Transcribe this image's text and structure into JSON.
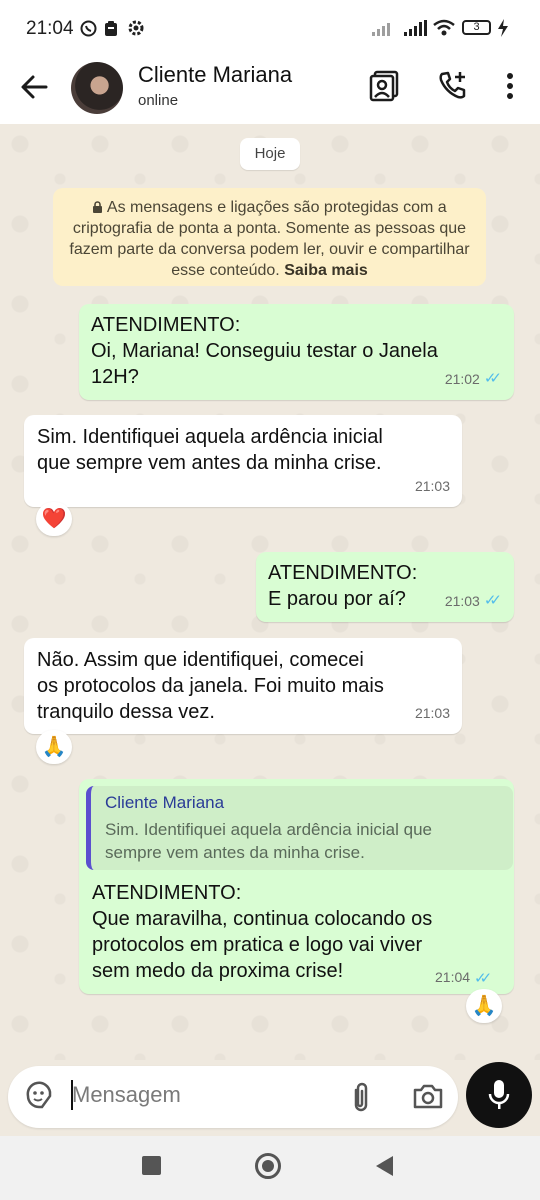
{
  "status_bar": {
    "time": "21:04",
    "battery": "3"
  },
  "header": {
    "back_icon": "arrow-left-icon",
    "contact_name": "Cliente Mariana",
    "contact_status": "online"
  },
  "date_chip": "Hoje",
  "encryption_notice": {
    "text": "As mensagens e ligações são protegidas com a criptografia de ponta a ponta. Somente as pessoas que fazem parte da conversa podem ler, ouvir e compartilhar esse conteúdo.",
    "link": "Saiba mais"
  },
  "messages": [
    {
      "text": "ATENDIMENTO:\nOi, Mariana! Conseguiu testar o Janela\n12H?",
      "time": "21:02"
    },
    {
      "text": "Sim. Identifiquei aquela ardência inicial\nque sempre vem antes da minha crise.",
      "time": "21:03",
      "reaction": "❤️"
    },
    {
      "text": "ATENDIMENTO:\nE parou por aí?",
      "time": "21:03"
    },
    {
      "text": "Não. Assim que identifiquei, comecei\nos protocolos da janela. Foi muito mais\ntranquilo dessa vez.",
      "time": "21:03",
      "reaction": "🙏"
    },
    {
      "quote_name": "Cliente Mariana",
      "quote_text": "Sim. Identifiquei aquela ardência inicial que\nsempre vem antes da minha crise.",
      "text": "ATENDIMENTO:\nQue maravilha, continua colocando os\nprotocolos em pratica e logo vai viver\nsem medo da proxima crise!",
      "time": "21:04",
      "reaction": "🙏"
    }
  ],
  "composer": {
    "placeholder": "Mensagem"
  },
  "colors": {
    "outgoing": "#d9fdd3",
    "incoming": "#ffffff",
    "read_ticks": "#53bdeb",
    "notice": "#fdf0c9"
  }
}
